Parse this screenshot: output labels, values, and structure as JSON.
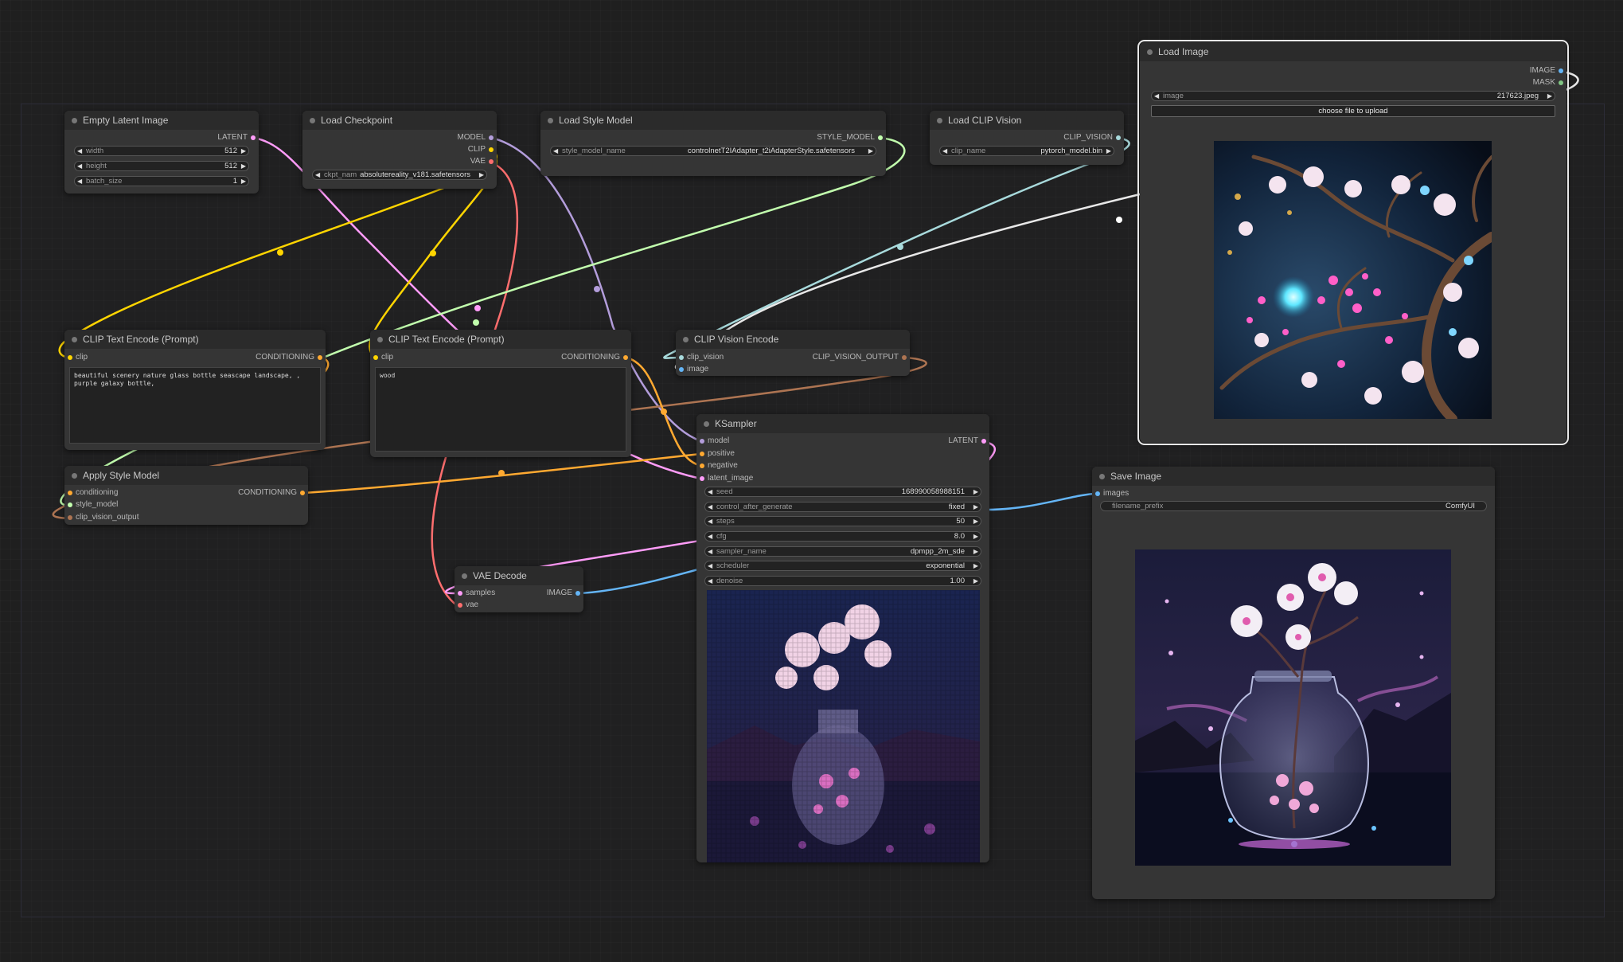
{
  "colors": {
    "canvas": "#1f1f1f",
    "node": "#353535",
    "title": "#2b2b2b",
    "model": "#b39ddb",
    "clip": "#ffd500",
    "vae": "#ff6e6e",
    "latent": "#ff9cf9",
    "conditioning": "#ffa931",
    "image": "#64b5f6",
    "mask": "#81c784",
    "style_model": "#c2ffae",
    "clip_vision": "#a8dadc",
    "clip_vision_output": "#ad7452"
  },
  "nodes": {
    "empty_latent": {
      "title": "Empty Latent Image",
      "out": "LATENT",
      "width_label": "width",
      "width": "512",
      "height_label": "height",
      "height": "512",
      "batch_label": "batch_size",
      "batch": "1"
    },
    "load_checkpoint": {
      "title": "Load Checkpoint",
      "out_model": "MODEL",
      "out_clip": "CLIP",
      "out_vae": "VAE",
      "ckpt_label": "ckpt_nam",
      "ckpt": "absolutereality_v181.safetensors"
    },
    "load_style_model": {
      "title": "Load Style Model",
      "out": "STYLE_MODEL",
      "label": "style_model_name",
      "value": "controlnetT2IAdapter_t2iAdapterStyle.safetensors"
    },
    "load_clip_vision": {
      "title": "Load CLIP Vision",
      "out": "CLIP_VISION",
      "label": "clip_name",
      "value": "pytorch_model.bin"
    },
    "load_image": {
      "title": "Load Image",
      "out_image": "IMAGE",
      "out_mask": "MASK",
      "label": "image",
      "value": "217623.jpeg",
      "upload": "choose file to upload"
    },
    "clip_text_1": {
      "title": "CLIP Text Encode (Prompt)",
      "in": "clip",
      "out": "CONDITIONING",
      "text": "beautiful scenery nature glass bottle seascape landscape, , purple galaxy bottle,"
    },
    "clip_text_2": {
      "title": "CLIP Text Encode (Prompt)",
      "in": "clip",
      "out": "CONDITIONING",
      "text": "wood"
    },
    "clip_vision_encode": {
      "title": "CLIP Vision Encode",
      "in_vision": "clip_vision",
      "in_image": "image",
      "out": "CLIP_VISION_OUTPUT"
    },
    "apply_style": {
      "title": "Apply Style Model",
      "in_cond": "conditioning",
      "in_style": "style_model",
      "in_cvo": "clip_vision_output",
      "out": "CONDITIONING"
    },
    "ksampler": {
      "title": "KSampler",
      "in_model": "model",
      "in_positive": "positive",
      "in_negative": "negative",
      "in_latent": "latent_image",
      "out": "LATENT",
      "seed_label": "seed",
      "seed": "168990058988151",
      "cag_label": "control_after_generate",
      "cag": "fixed",
      "steps_label": "steps",
      "steps": "50",
      "cfg_label": "cfg",
      "cfg": "8.0",
      "sampler_label": "sampler_name",
      "sampler": "dpmpp_2m_sde",
      "scheduler_label": "scheduler",
      "scheduler": "exponential",
      "denoise_label": "denoise",
      "denoise": "1.00"
    },
    "vae_decode": {
      "title": "VAE Decode",
      "in_samples": "samples",
      "in_vae": "vae",
      "out": "IMAGE"
    },
    "save_image": {
      "title": "Save Image",
      "in": "images",
      "prefix_label": "filename_prefix",
      "prefix": "ComfyUI"
    }
  }
}
